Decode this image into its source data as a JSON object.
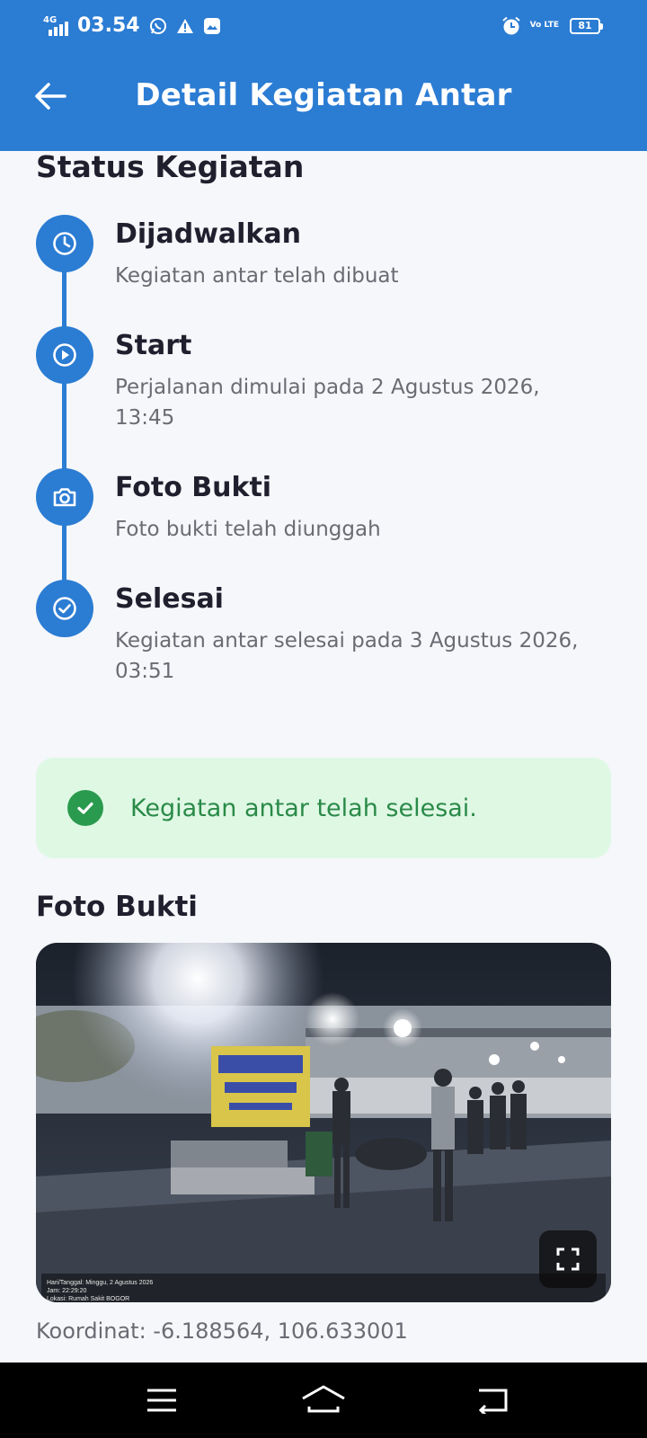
{
  "status_bar": {
    "network": "4G",
    "time": "03.54",
    "volte": "Vo LTE",
    "battery": "81",
    "icons": [
      "whatsapp-icon",
      "warning-icon",
      "gallery-icon",
      "alarm-icon"
    ]
  },
  "app_bar": {
    "title": "Detail Kegiatan Antar",
    "back_icon": "arrow-left-icon"
  },
  "status_section": {
    "title": "Status Kegiatan",
    "steps": [
      {
        "icon": "clock-icon",
        "title": "Dijadwalkan",
        "desc": "Kegiatan antar telah dibuat"
      },
      {
        "icon": "play-circle-icon",
        "title": "Start",
        "desc": "Perjalanan dimulai pada 2 Agustus 2026, 13:45"
      },
      {
        "icon": "camera-icon",
        "title": "Foto Bukti",
        "desc": "Foto bukti telah diunggah"
      },
      {
        "icon": "check-circle-icon",
        "title": "Selesai",
        "desc": "Kegiatan antar selesai pada 3 Agustus 2026, 03:51"
      }
    ]
  },
  "alert": {
    "text": "Kegiatan antar telah selesai.",
    "icon": "check-circle-icon"
  },
  "photo_section": {
    "title": "Foto Bukti",
    "stamp": [
      "Hari/Tanggal: Minggu, 2 Agustus 2026",
      "Jam: 22:29:20",
      "Lokasi: Rumah Sakit BOGOR"
    ],
    "expand_icon": "fullscreen-icon",
    "coords": "Koordinat: -6.188564, 106.633001"
  },
  "nav_bar": {
    "buttons": [
      "menu-icon",
      "home-icon",
      "back-icon"
    ]
  },
  "colors": {
    "primary": "#2b7cd3",
    "success_bg": "#dff8e4",
    "success_text": "#2a8a48",
    "success_icon": "#2a9a4e",
    "muted_text": "#6b6b73"
  }
}
